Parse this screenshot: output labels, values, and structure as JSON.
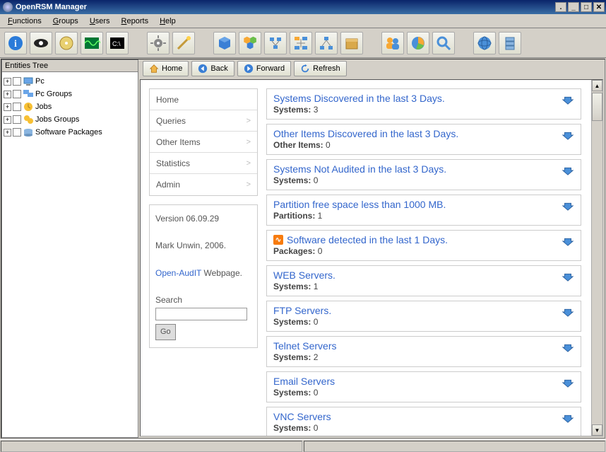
{
  "title": "OpenRSM Manager",
  "menu": [
    "Functions",
    "Groups",
    "Users",
    "Reports",
    "Help"
  ],
  "browse": {
    "home": "Home",
    "back": "Back",
    "forward": "Forward",
    "refresh": "Refresh"
  },
  "entities_title": "Entities Tree",
  "tree": [
    {
      "label": "Pc",
      "icon": "pc"
    },
    {
      "label": "Pc Groups",
      "icon": "pcgroup"
    },
    {
      "label": "Jobs",
      "icon": "job"
    },
    {
      "label": "Jobs Groups",
      "icon": "jobgroup"
    },
    {
      "label": "Software Packages",
      "icon": "pkg"
    }
  ],
  "nav": [
    {
      "label": "Home",
      "chev": false
    },
    {
      "label": "Queries",
      "chev": true
    },
    {
      "label": "Other Items",
      "chev": true
    },
    {
      "label": "Statistics",
      "chev": true
    },
    {
      "label": "Admin",
      "chev": true
    }
  ],
  "info": {
    "version": "Version 06.09.29",
    "author": "Mark Unwin, 2006.",
    "link": "Open-AudIT",
    "webpage": "Webpage.",
    "search_label": "Search",
    "go": "Go"
  },
  "cards": [
    {
      "title": "Systems Discovered in the last 3 Days.",
      "meta_label": "Systems:",
      "meta_value": "3",
      "rss": false
    },
    {
      "title": "Other Items Discovered in the last 3 Days.",
      "meta_label": "Other Items:",
      "meta_value": "0",
      "rss": false
    },
    {
      "title": "Systems Not Audited in the last 3 Days.",
      "meta_label": "Systems:",
      "meta_value": "0",
      "rss": false
    },
    {
      "title": "Partition free space less than 1000 MB.",
      "meta_label": "Partitions:",
      "meta_value": "1",
      "rss": false
    },
    {
      "title": "Software detected in the last 1 Days.",
      "meta_label": "Packages:",
      "meta_value": "0",
      "rss": true
    },
    {
      "title": "WEB Servers.",
      "meta_label": "Systems:",
      "meta_value": "1",
      "rss": false
    },
    {
      "title": "FTP Servers.",
      "meta_label": "Systems:",
      "meta_value": "0",
      "rss": false
    },
    {
      "title": "Telnet Servers",
      "meta_label": "Systems:",
      "meta_value": "2",
      "rss": false
    },
    {
      "title": "Email Servers",
      "meta_label": "Systems:",
      "meta_value": "0",
      "rss": false
    },
    {
      "title": "VNC Servers",
      "meta_label": "Systems:",
      "meta_value": "0",
      "rss": false
    }
  ],
  "toolbar_icons": [
    "info",
    "eye",
    "disc",
    "wave",
    "console",
    "sep",
    "gear",
    "wand",
    "sep",
    "cube",
    "cubes",
    "net1",
    "net2",
    "net3",
    "pkg",
    "sep",
    "users",
    "pie",
    "search",
    "sep",
    "globe",
    "server"
  ]
}
